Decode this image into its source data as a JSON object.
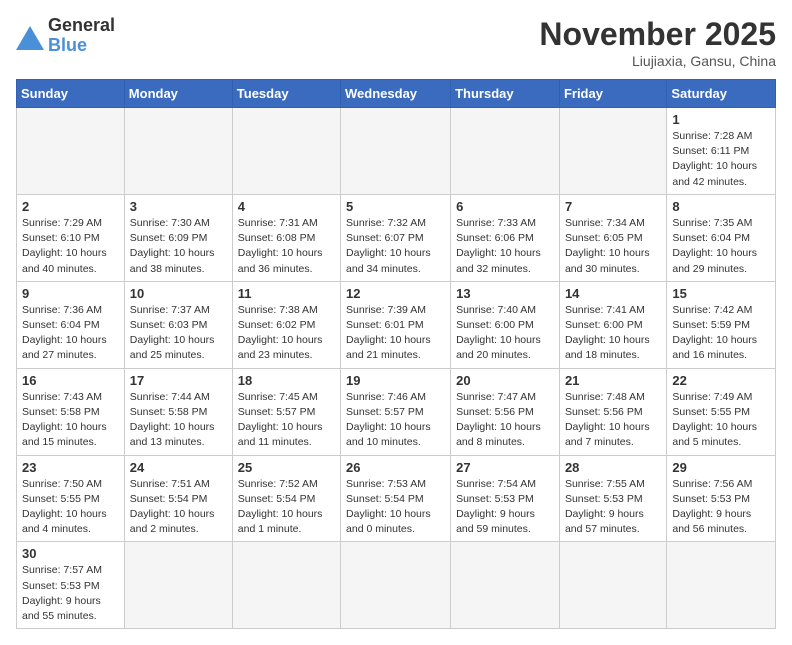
{
  "header": {
    "logo_general": "General",
    "logo_blue": "Blue",
    "title": "November 2025",
    "location": "Liujiaxia, Gansu, China"
  },
  "days_of_week": [
    "Sunday",
    "Monday",
    "Tuesday",
    "Wednesday",
    "Thursday",
    "Friday",
    "Saturday"
  ],
  "weeks": [
    [
      {
        "day": "",
        "info": ""
      },
      {
        "day": "",
        "info": ""
      },
      {
        "day": "",
        "info": ""
      },
      {
        "day": "",
        "info": ""
      },
      {
        "day": "",
        "info": ""
      },
      {
        "day": "",
        "info": ""
      },
      {
        "day": "1",
        "info": "Sunrise: 7:28 AM\nSunset: 6:11 PM\nDaylight: 10 hours and 42 minutes."
      }
    ],
    [
      {
        "day": "2",
        "info": "Sunrise: 7:29 AM\nSunset: 6:10 PM\nDaylight: 10 hours and 40 minutes."
      },
      {
        "day": "3",
        "info": "Sunrise: 7:30 AM\nSunset: 6:09 PM\nDaylight: 10 hours and 38 minutes."
      },
      {
        "day": "4",
        "info": "Sunrise: 7:31 AM\nSunset: 6:08 PM\nDaylight: 10 hours and 36 minutes."
      },
      {
        "day": "5",
        "info": "Sunrise: 7:32 AM\nSunset: 6:07 PM\nDaylight: 10 hours and 34 minutes."
      },
      {
        "day": "6",
        "info": "Sunrise: 7:33 AM\nSunset: 6:06 PM\nDaylight: 10 hours and 32 minutes."
      },
      {
        "day": "7",
        "info": "Sunrise: 7:34 AM\nSunset: 6:05 PM\nDaylight: 10 hours and 30 minutes."
      },
      {
        "day": "8",
        "info": "Sunrise: 7:35 AM\nSunset: 6:04 PM\nDaylight: 10 hours and 29 minutes."
      }
    ],
    [
      {
        "day": "9",
        "info": "Sunrise: 7:36 AM\nSunset: 6:04 PM\nDaylight: 10 hours and 27 minutes."
      },
      {
        "day": "10",
        "info": "Sunrise: 7:37 AM\nSunset: 6:03 PM\nDaylight: 10 hours and 25 minutes."
      },
      {
        "day": "11",
        "info": "Sunrise: 7:38 AM\nSunset: 6:02 PM\nDaylight: 10 hours and 23 minutes."
      },
      {
        "day": "12",
        "info": "Sunrise: 7:39 AM\nSunset: 6:01 PM\nDaylight: 10 hours and 21 minutes."
      },
      {
        "day": "13",
        "info": "Sunrise: 7:40 AM\nSunset: 6:00 PM\nDaylight: 10 hours and 20 minutes."
      },
      {
        "day": "14",
        "info": "Sunrise: 7:41 AM\nSunset: 6:00 PM\nDaylight: 10 hours and 18 minutes."
      },
      {
        "day": "15",
        "info": "Sunrise: 7:42 AM\nSunset: 5:59 PM\nDaylight: 10 hours and 16 minutes."
      }
    ],
    [
      {
        "day": "16",
        "info": "Sunrise: 7:43 AM\nSunset: 5:58 PM\nDaylight: 10 hours and 15 minutes."
      },
      {
        "day": "17",
        "info": "Sunrise: 7:44 AM\nSunset: 5:58 PM\nDaylight: 10 hours and 13 minutes."
      },
      {
        "day": "18",
        "info": "Sunrise: 7:45 AM\nSunset: 5:57 PM\nDaylight: 10 hours and 11 minutes."
      },
      {
        "day": "19",
        "info": "Sunrise: 7:46 AM\nSunset: 5:57 PM\nDaylight: 10 hours and 10 minutes."
      },
      {
        "day": "20",
        "info": "Sunrise: 7:47 AM\nSunset: 5:56 PM\nDaylight: 10 hours and 8 minutes."
      },
      {
        "day": "21",
        "info": "Sunrise: 7:48 AM\nSunset: 5:56 PM\nDaylight: 10 hours and 7 minutes."
      },
      {
        "day": "22",
        "info": "Sunrise: 7:49 AM\nSunset: 5:55 PM\nDaylight: 10 hours and 5 minutes."
      }
    ],
    [
      {
        "day": "23",
        "info": "Sunrise: 7:50 AM\nSunset: 5:55 PM\nDaylight: 10 hours and 4 minutes."
      },
      {
        "day": "24",
        "info": "Sunrise: 7:51 AM\nSunset: 5:54 PM\nDaylight: 10 hours and 2 minutes."
      },
      {
        "day": "25",
        "info": "Sunrise: 7:52 AM\nSunset: 5:54 PM\nDaylight: 10 hours and 1 minute."
      },
      {
        "day": "26",
        "info": "Sunrise: 7:53 AM\nSunset: 5:54 PM\nDaylight: 10 hours and 0 minutes."
      },
      {
        "day": "27",
        "info": "Sunrise: 7:54 AM\nSunset: 5:53 PM\nDaylight: 9 hours and 59 minutes."
      },
      {
        "day": "28",
        "info": "Sunrise: 7:55 AM\nSunset: 5:53 PM\nDaylight: 9 hours and 57 minutes."
      },
      {
        "day": "29",
        "info": "Sunrise: 7:56 AM\nSunset: 5:53 PM\nDaylight: 9 hours and 56 minutes."
      }
    ],
    [
      {
        "day": "30",
        "info": "Sunrise: 7:57 AM\nSunset: 5:53 PM\nDaylight: 9 hours and 55 minutes."
      },
      {
        "day": "",
        "info": ""
      },
      {
        "day": "",
        "info": ""
      },
      {
        "day": "",
        "info": ""
      },
      {
        "day": "",
        "info": ""
      },
      {
        "day": "",
        "info": ""
      },
      {
        "day": "",
        "info": ""
      }
    ]
  ]
}
